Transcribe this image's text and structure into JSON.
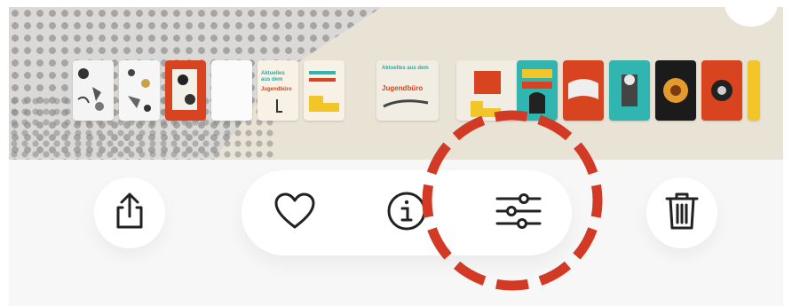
{
  "toolbar": {
    "share_icon": "share-icon",
    "favorite_icon": "heart-icon",
    "info_icon": "info-icon",
    "adjust_icon": "sliders-icon",
    "delete_icon": "trash-icon"
  },
  "thumbnail_strip": {
    "thumb_text_a": "Aktuelles aus dem",
    "thumb_text_b": "Jugendbüro",
    "thumb_text_c": "Jugendbüro"
  },
  "colors": {
    "highlight_ring": "#d23a26",
    "icon": "#222222",
    "orange": "#d8441f",
    "teal": "#31b5b0",
    "yellow": "#f2c628",
    "black": "#1b1b1b"
  },
  "annotation": {
    "highlighted_control": "sliders-icon"
  }
}
